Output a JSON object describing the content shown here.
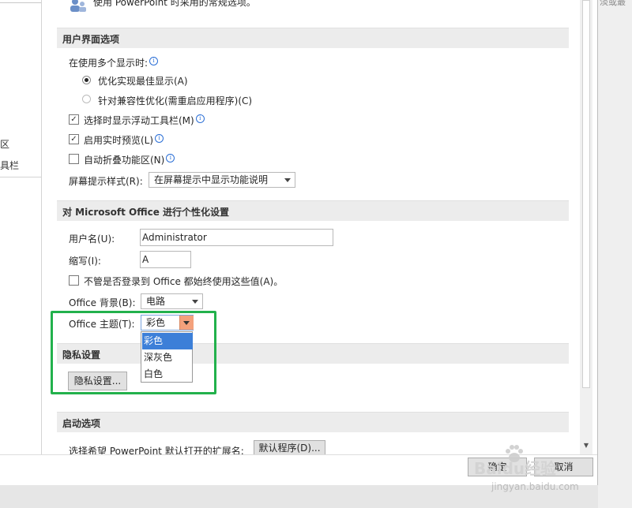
{
  "background_text": "淡或最",
  "left_nav": {
    "items": [
      "区",
      "具栏"
    ]
  },
  "top_partial_text": "使用 PowerPoint 时采用的常规选项。",
  "ui_options": {
    "header": "用户界面选项",
    "multi_display_label": "在使用多个显示时:",
    "radio_optimize": "优化实现最佳显示(A)",
    "radio_compat": "针对兼容性优化(需重启应用程序)(C)",
    "radio_selected": "optimize",
    "check_mini_toolbar": "选择时显示浮动工具栏(M)",
    "check_live_preview": "启用实时预览(L)",
    "check_collapse_ribbon": "自动折叠功能区(N)",
    "screentip_label": "屏幕提示样式(R):",
    "screentip_value": "在屏幕提示中显示功能说明",
    "checks": {
      "mini_toolbar": true,
      "live_preview": true,
      "collapse_ribbon": false
    }
  },
  "personalize": {
    "header": "对 Microsoft Office 进行个性化设置",
    "username_label": "用户名(U):",
    "username_value": "Administrator",
    "initials_label": "缩写(I):",
    "initials_value": "A",
    "always_use_label": "不管是否登录到 Office 都始终使用这些值(A)。",
    "always_use_checked": false,
    "background_label": "Office 背景(B):",
    "background_value": "电路",
    "theme_label": "Office 主题(T):",
    "theme_value": "彩色",
    "theme_options": [
      "彩色",
      "深灰色",
      "白色"
    ],
    "theme_highlighted": "彩色",
    "highlight_color": "#22b14c"
  },
  "privacy": {
    "header": "隐私设置",
    "button": "隐私设置..."
  },
  "startup": {
    "header": "启动选项",
    "extension_label": "选择希望 PowerPoint 默认打开的扩展名:",
    "default_programs_button": "默认程序(D)..."
  },
  "footer": {
    "ok_button": "确定",
    "cancel_button": "取消"
  },
  "watermark": {
    "brand": "Baidu经验",
    "url": "jingyan.baidu.com"
  },
  "icons": [
    "people-options-icon",
    "info-icon",
    "dropdown-arrow-icon",
    "paw-icon",
    "scroll-down-arrow-icon"
  ]
}
